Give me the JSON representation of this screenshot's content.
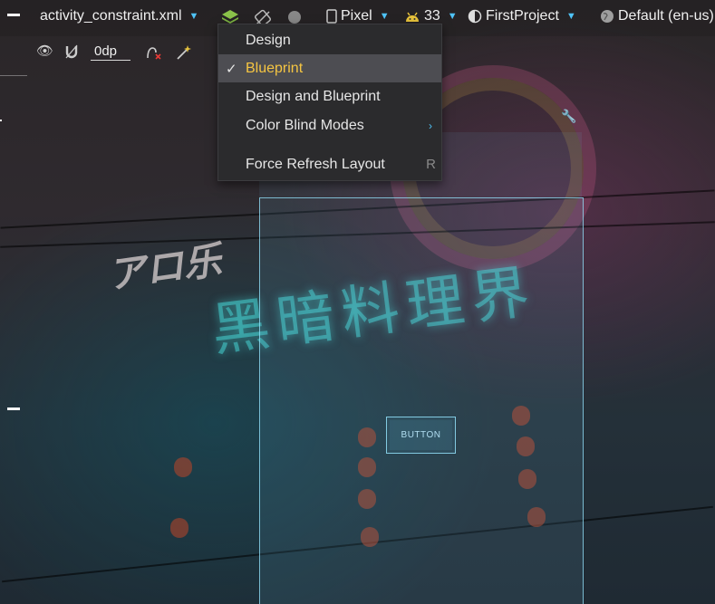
{
  "toolbar": {
    "file_name": "activity_constraint.xml",
    "device": "Pixel",
    "api_level": "33",
    "theme": "FirstProject",
    "locale": "Default (en-us)"
  },
  "toolbar2": {
    "default_margin": "0dp"
  },
  "menu": {
    "items": [
      {
        "label": "Design",
        "selected": false
      },
      {
        "label": "Blueprint",
        "selected": true,
        "check": "✓"
      },
      {
        "label": "Design and Blueprint",
        "selected": false
      },
      {
        "label": "Color Blind Modes",
        "selected": false,
        "submenu_arrow": "›"
      },
      {
        "label": "Force Refresh Layout",
        "selected": false,
        "shortcut": "R"
      }
    ]
  },
  "canvas": {
    "button_text": "BUTTON"
  },
  "background": {
    "neon_text": "黑暗料理界",
    "neon_logo": "アロ乐"
  },
  "icons": {
    "layers": "layers-icon",
    "orientation": "orientation-icon",
    "night_mode": "night-mode-icon",
    "phone": "phone-icon",
    "android": "android-icon",
    "theme": "theme-icon",
    "globe": "globe-icon",
    "eye": "eye-icon",
    "magnet": "magnet-icon",
    "clear_constraints": "clear-constraints-icon",
    "magic_wand": "magic-wand-icon",
    "wrench": "wrench-icon"
  },
  "colors": {
    "accent": "#4fc3f7",
    "selected_label": "#f5c542",
    "menu_bg": "#2b2b2d",
    "selected_bg": "#4d4d52",
    "blueprint_outline": "#96e6ff"
  }
}
